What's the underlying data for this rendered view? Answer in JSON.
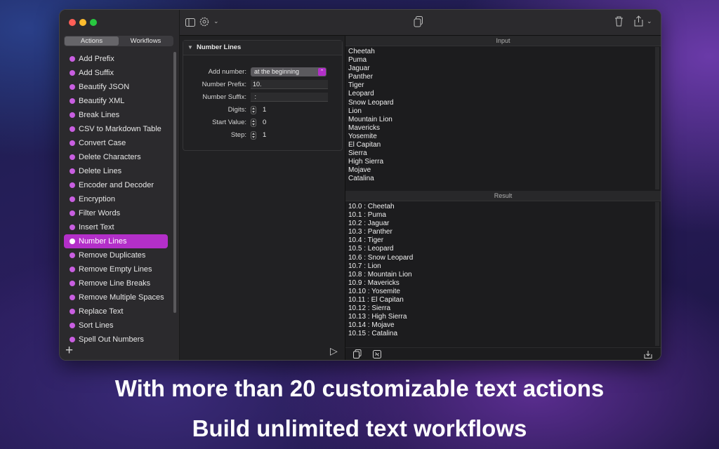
{
  "sidebar": {
    "segments": [
      {
        "label": "Actions",
        "active": true
      },
      {
        "label": "Workflows",
        "active": false
      }
    ],
    "items": [
      {
        "label": "Add Prefix"
      },
      {
        "label": "Add Suffix"
      },
      {
        "label": "Beautify JSON"
      },
      {
        "label": "Beautify XML"
      },
      {
        "label": "Break Lines"
      },
      {
        "label": "CSV to Markdown Table"
      },
      {
        "label": "Convert Case"
      },
      {
        "label": "Delete Characters"
      },
      {
        "label": "Delete Lines"
      },
      {
        "label": "Encoder and Decoder"
      },
      {
        "label": "Encryption"
      },
      {
        "label": "Filter Words"
      },
      {
        "label": "Insert Text"
      },
      {
        "label": "Number Lines",
        "selected": true
      },
      {
        "label": "Remove Duplicates"
      },
      {
        "label": "Remove Empty Lines"
      },
      {
        "label": "Remove Line Breaks"
      },
      {
        "label": "Remove Multiple Spaces"
      },
      {
        "label": "Replace Text"
      },
      {
        "label": "Sort Lines"
      },
      {
        "label": "Spell Out Numbers"
      }
    ],
    "add_icon": "plus-icon",
    "dot_color": "#c95ee1",
    "selected_color": "#b32fc9"
  },
  "toolbar": {
    "icons": [
      "sidebar-toggle-icon",
      "gear-icon",
      "chevron-down-icon",
      "copy-icon",
      "trash-icon",
      "share-icon"
    ]
  },
  "settings": {
    "title": "Number Lines",
    "add_number": {
      "label": "Add number:",
      "value": "at the beginning"
    },
    "number_prefix": {
      "label": "Number Prefix:",
      "value": "10."
    },
    "number_suffix": {
      "label": "Number Suffix:",
      "value": " : "
    },
    "digits": {
      "label": "Digits:",
      "value": "1"
    },
    "start_value": {
      "label": "Start Value:",
      "value": "0"
    },
    "step": {
      "label": "Step:",
      "value": "1"
    }
  },
  "input": {
    "header": "Input",
    "lines": [
      "Cheetah",
      "Puma",
      "Jaguar",
      "Panther",
      "Tiger",
      "Leopard",
      "Snow Leopard",
      "Lion",
      "Mountain Lion",
      "Mavericks",
      "Yosemite",
      "El Capitan",
      "Sierra",
      "High Sierra",
      "Mojave",
      "Catalina"
    ]
  },
  "result": {
    "header": "Result",
    "lines": [
      "10.0 : Cheetah",
      "10.1 : Puma",
      "10.2 : Jaguar",
      "10.3 : Panther",
      "10.4 : Tiger",
      "10.5 : Leopard",
      "10.6 : Snow Leopard",
      "10.7 : Lion",
      "10.8 : Mountain Lion",
      "10.9 : Mavericks",
      "10.10 : Yosemite",
      "10.11 : El Capitan",
      "10.12 : Sierra",
      "10.13 : High Sierra",
      "10.14 : Mojave",
      "10.15 : Catalina"
    ]
  },
  "captions": {
    "line1": "With more than 20 customizable text actions",
    "line2": "Build unlimited text workflows"
  }
}
